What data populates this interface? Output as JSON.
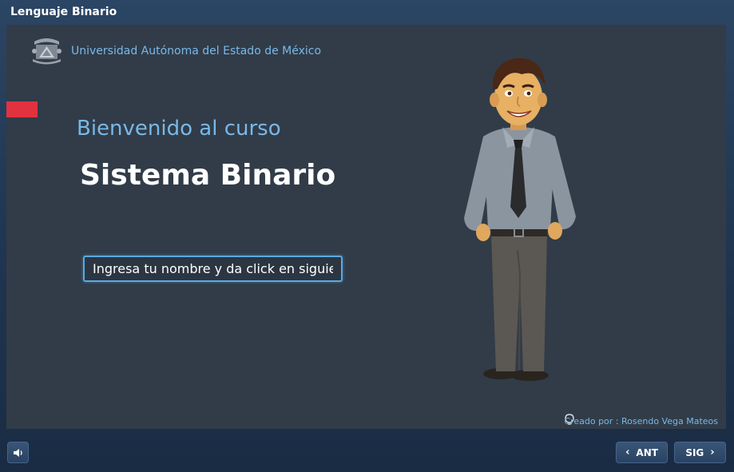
{
  "window": {
    "title": "Lenguaje Binario"
  },
  "slide": {
    "university": "Universidad Autónoma del Estado de México",
    "welcome": "Bienvenido al curso",
    "course_title": "Sistema Binario",
    "name_input": {
      "placeholder": "Ingresa tu nombre y da click en siguiente",
      "value": ""
    },
    "credit": "Creado por : Rosendo Vega Mateos"
  },
  "controls": {
    "audio_icon": "speaker-icon",
    "prev_label": "ANT",
    "next_label": "SIG"
  },
  "colors": {
    "accent_text": "#79b8e8",
    "marker": "#e2323f",
    "slide_bg": "#313c48",
    "frame_bg": "#1f3550"
  }
}
